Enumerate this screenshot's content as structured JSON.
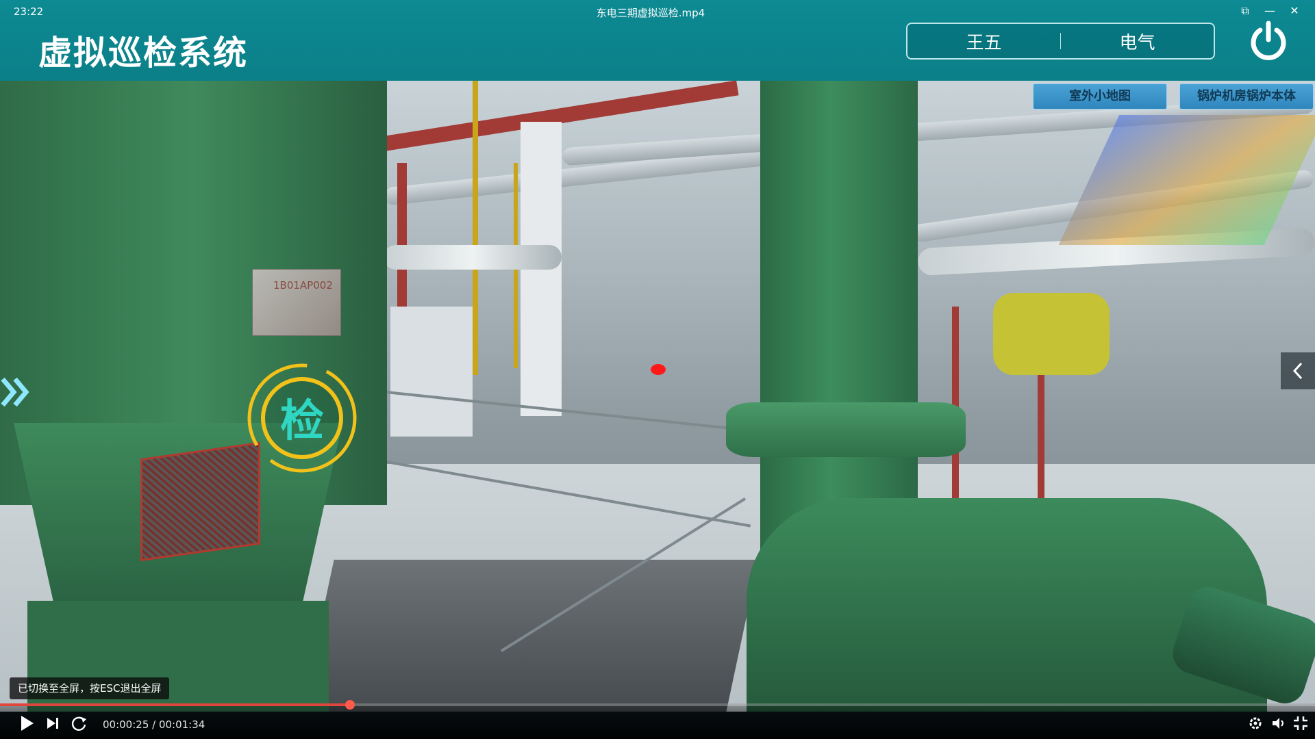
{
  "window": {
    "clock": "23:22",
    "video_title": "东电三期虚拟巡检.mp4",
    "controls": {
      "restore": "⧉",
      "minimize": "—",
      "close": "✕"
    }
  },
  "header": {
    "system_title": "虚拟巡检系统",
    "user_name": "王五",
    "department": "电气",
    "power_icon": "power-icon"
  },
  "scene": {
    "map_buttons": [
      "室外小地图",
      "锅炉机房锅炉本体"
    ],
    "inspect_badge": "检",
    "nameplate_text": "1B01AP002",
    "left_expand_icon": "double-chevron-right-icon",
    "right_collapse_icon": "chevron-left-icon"
  },
  "toast": {
    "message": "已切换至全屏，按ESC退出全屏"
  },
  "player": {
    "current_time": "00:00:25",
    "total_time": "00:01:34",
    "time_display": "00:00:25 / 00:01:34",
    "progress": 0.266,
    "icons": [
      "play-icon",
      "next-icon",
      "loop-icon",
      "settings-icon",
      "volume-icon",
      "exit-fullscreen-icon"
    ]
  },
  "colors": {
    "header_bg": "#0d8a93",
    "accent_yellow": "#f2c21b",
    "map_button_blue": "#3a93c8",
    "progress_red": "#e2453b"
  }
}
